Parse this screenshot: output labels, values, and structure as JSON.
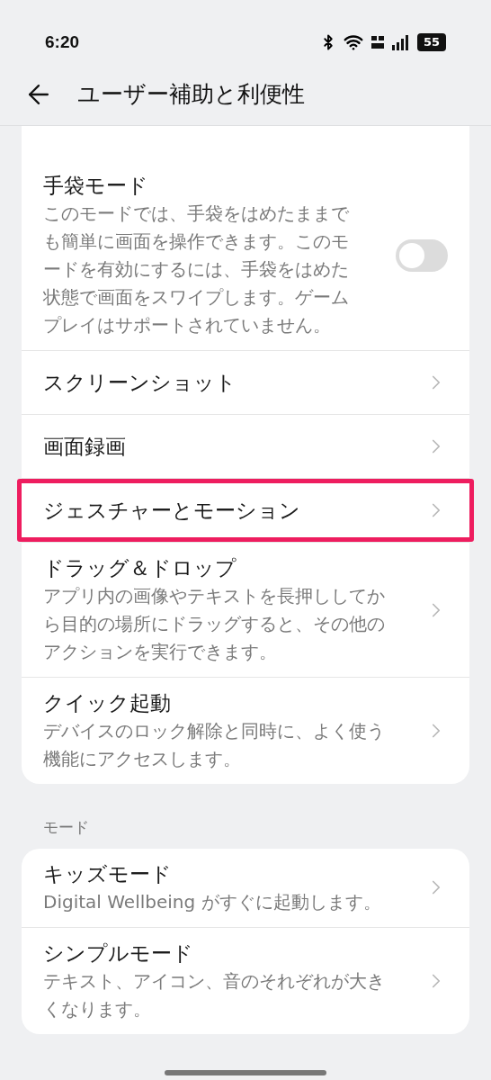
{
  "status_bar": {
    "time": "6:20",
    "battery": "55"
  },
  "header": {
    "title": "ユーザー補助と利便性"
  },
  "sections": [
    {
      "items": [
        {
          "kind": "toggle",
          "title": "手袋モード",
          "description": "このモードでは、手袋をはめたままでも簡単に画面を操作できます。このモードを有効にするには、手袋をはめた状態で画面をスワイプします。ゲームプレイはサポートされていません。",
          "on": false,
          "highlighted": false
        },
        {
          "kind": "link",
          "title": "スクリーンショット",
          "highlighted": false
        },
        {
          "kind": "link",
          "title": "画面録画",
          "highlighted": false
        },
        {
          "kind": "link",
          "title": "ジェスチャーとモーション",
          "highlighted": true
        },
        {
          "kind": "link",
          "title": "ドラッグ＆ドロップ",
          "description": "アプリ内の画像やテキストを長押ししてから目的の場所にドラッグすると、その他のアクションを実行できます。",
          "highlighted": false
        },
        {
          "kind": "link",
          "title": "クイック起動",
          "description": "デバイスのロック解除と同時に、よく使う機能にアクセスします。",
          "highlighted": false
        }
      ]
    },
    {
      "label": "モード",
      "items": [
        {
          "kind": "link",
          "title": "キッズモード",
          "description": "Digital Wellbeing がすぐに起動します。",
          "highlighted": false
        },
        {
          "kind": "link",
          "title": "シンプルモード",
          "description": "テキスト、アイコン、音のそれぞれが大きくなります。",
          "highlighted": false
        }
      ]
    }
  ]
}
